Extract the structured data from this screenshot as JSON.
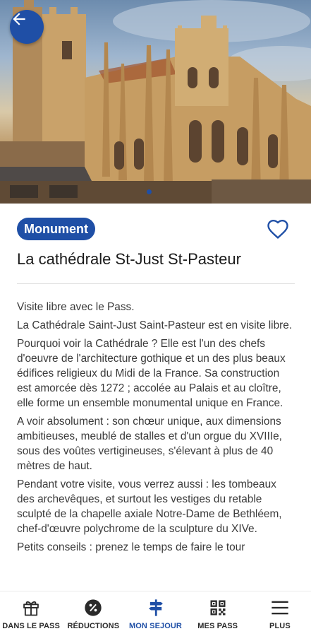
{
  "place": {
    "category": "Monument",
    "title": "La cathédrale St-Just St-Pasteur",
    "carousel_active_index": 0
  },
  "description": {
    "paragraphs": [
      "Visite libre avec le Pass.",
      "La Cathédrale Saint-Just Saint-Pasteur est en visite libre.",
      "Pourquoi voir la Cathédrale ? Elle est l'un des chefs d'oeuvre de l'architecture gothique et un des plus beaux édifices religieux du Midi de la France. Sa construction est amorcée dès 1272 ; accolée au Palais et au cloître, elle forme un ensemble monumental unique en France.",
      "A voir absolument : son chœur unique, aux dimensions ambitieuses, meublé de stalles et d'un orgue du XVIIIe, sous des voûtes vertigineuses, s'élevant à plus de 40 mètres de haut.",
      "Pendant votre visite, vous verrez aussi : les tombeaux des archevêques, et surtout les vestiges du retable sculpté de la chapelle axiale Notre-Dame de Bethléem, chef-d'œuvre polychrome de la sculpture du XIVe.",
      "Petits conseils : prenez le temps de faire le tour"
    ]
  },
  "nav": {
    "items": [
      {
        "label": "DANS LE PASS",
        "icon": "gift-icon"
      },
      {
        "label": "RÉDUCTIONS",
        "icon": "percent-icon"
      },
      {
        "label": "MON SEJOUR",
        "icon": "signpost-icon",
        "active": true
      },
      {
        "label": "MES PASS",
        "icon": "qr-code-icon"
      },
      {
        "label": "PLUS",
        "icon": "menu-icon"
      }
    ]
  },
  "colors": {
    "primary": "#1f4fa6",
    "text": "#3a3a3a"
  }
}
